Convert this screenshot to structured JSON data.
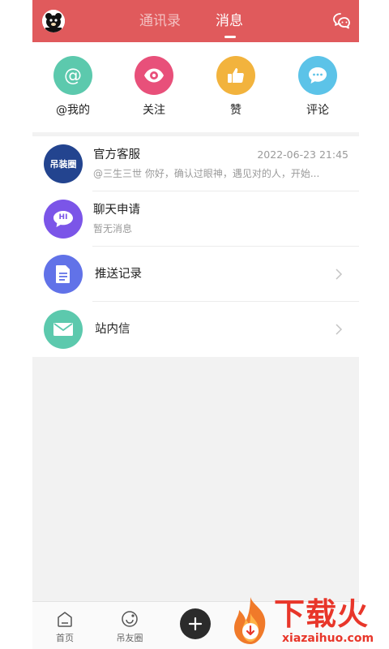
{
  "header": {
    "tabs": [
      {
        "label": "通讯录",
        "active": false
      },
      {
        "label": "消息",
        "active": true
      }
    ],
    "avatar_icon": "bear-avatar",
    "right_icon": "chat-bubbles-icon",
    "accent": "#e05a5c"
  },
  "quick_actions": [
    {
      "label": "@我的",
      "icon": "at-icon",
      "color": "#5cc9ad"
    },
    {
      "label": "关注",
      "icon": "eye-icon",
      "color": "#e8507a"
    },
    {
      "label": "赞",
      "icon": "thumbs-up-icon",
      "color": "#f2b33d"
    },
    {
      "label": "评论",
      "icon": "comment-icon",
      "color": "#5cc3e8"
    }
  ],
  "messages": [
    {
      "title": "官方客服",
      "time": "2022-06-23 21:45",
      "preview": "@三生三世 你好，确认过眼神，遇见对的人，开始...",
      "avatar_text": "吊装圈",
      "avatar_color": "#23448f"
    },
    {
      "title": "聊天申请",
      "preview": "暂无消息",
      "avatar_text": "HI",
      "avatar_color": "#7b55e8"
    }
  ],
  "menu_items": [
    {
      "label": "推送记录",
      "icon": "document-icon",
      "color": "#6172e8"
    },
    {
      "label": "站内信",
      "icon": "mail-icon",
      "color": "#5cc9ad"
    }
  ],
  "tabbar": [
    {
      "label": "首页",
      "icon": "home-icon"
    },
    {
      "label": "吊友圈",
      "icon": "circle-icon"
    }
  ],
  "watermark": {
    "main": "下载火",
    "sub": "xiazaihuo.com"
  }
}
